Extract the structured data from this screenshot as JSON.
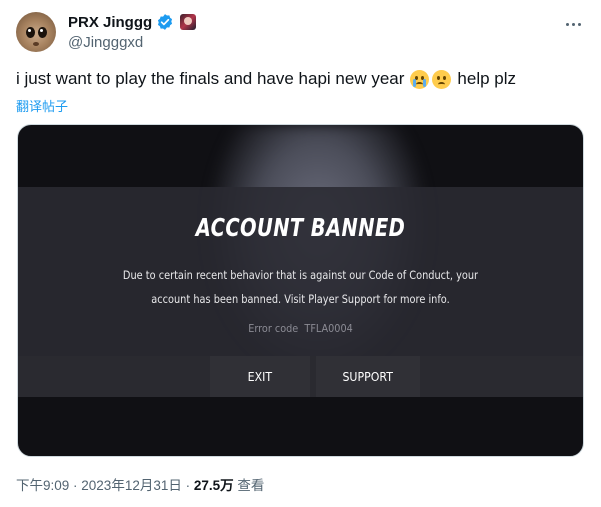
{
  "author": {
    "name": "PRX Jinggg",
    "handle": "@Jingggxd"
  },
  "tweet": {
    "text": "i just want to play the finals and have hapi new year",
    "text_suffix": "help plz",
    "emojis": [
      "crying-face-emoji",
      "slightly-frowning-face-emoji"
    ],
    "translate_label": "翻译帖子"
  },
  "media": {
    "title": "ACCOUNT BANNED",
    "description_line1": "Due to certain recent behavior that is against our Code of Conduct, your",
    "description_line2": "account has been banned. Visit Player Support for more info.",
    "error_label": "Error code",
    "error_code": "TFLA0004",
    "exit_label": "EXIT",
    "support_label": "SUPPORT"
  },
  "meta": {
    "time": "下午9:09",
    "separator": " · ",
    "date": "2023年12月31日",
    "views_count": "27.5万",
    "views_label": "查看"
  },
  "colors": {
    "verified": "#1d9bf0",
    "link": "#1d9bf0",
    "secondary_text": "#536471"
  }
}
